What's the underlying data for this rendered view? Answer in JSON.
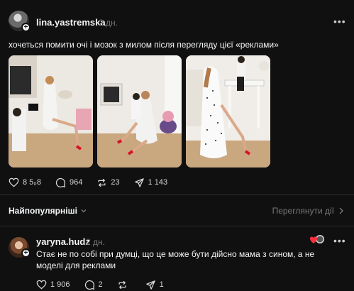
{
  "post": {
    "username": "lina.yastremska",
    "time": "2 дн.",
    "more_label": "•••",
    "text": "хочеться помити очі і мозок з милом після перегляду цієї «реклами»",
    "photos": [
      {
        "alt": "photo-1"
      },
      {
        "alt": "photo-2"
      },
      {
        "alt": "photo-3"
      }
    ],
    "actions": {
      "likes": "8 5₀8",
      "comments": "964",
      "reposts": "23",
      "shares": "1 143"
    },
    "icons": {
      "like": "heart-icon",
      "comment": "comment-icon",
      "repost": "repost-icon",
      "share": "share-icon",
      "more": "more-icon",
      "add": "plus-icon"
    }
  },
  "replies_header": {
    "sort_label": "Найпопулярніші",
    "view_activity_label": "Переглянути дії"
  },
  "reply": {
    "username": "yaryna.hudz",
    "time": "2 дн.",
    "more_label": "•••",
    "text": "Стає не по собі при думці, що це може бути дійсно мама з сином, а не моделі для реклами",
    "actions": {
      "likes": "1 906",
      "comments": "2",
      "reposts": "",
      "shares": "1"
    }
  },
  "colors": {
    "background": "#101010",
    "text_primary": "#f3f5f7",
    "text_secondary": "#777777",
    "divider": "#2a2a2a",
    "liked_red": "#ff3040"
  }
}
